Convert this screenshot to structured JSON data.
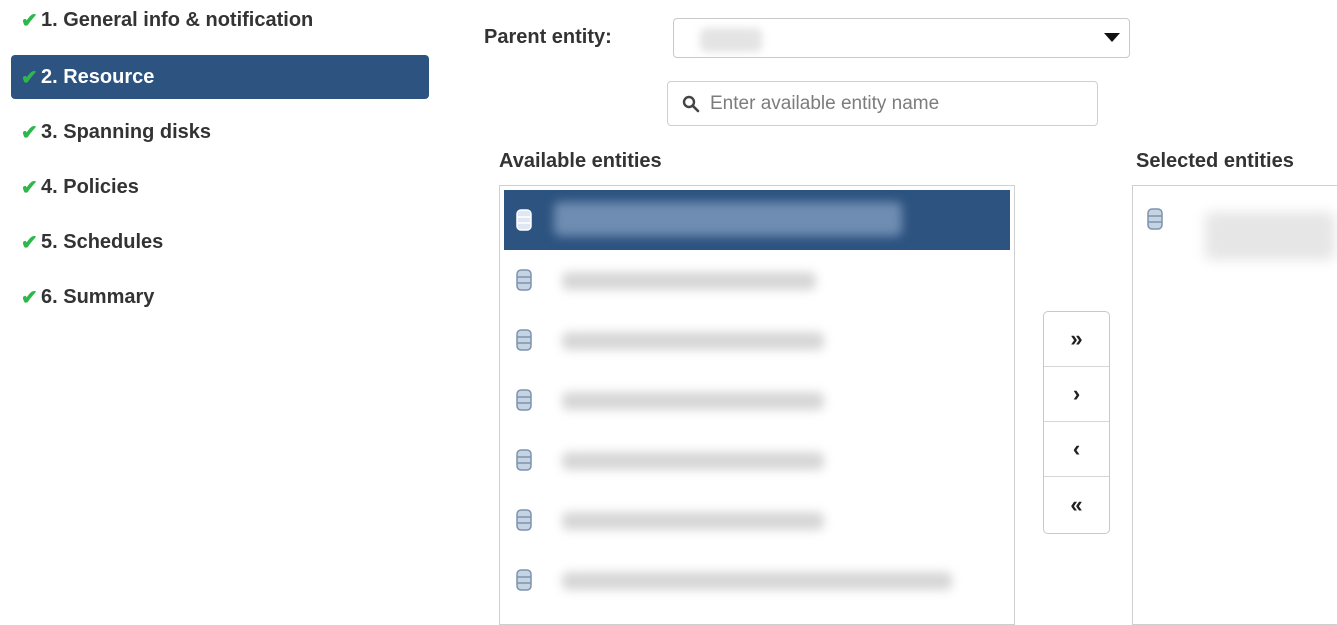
{
  "wizard": {
    "steps": [
      {
        "label": "1. General info & notification",
        "check": "✔"
      },
      {
        "label": "2. Resource",
        "check": "✔"
      },
      {
        "label": "3. Spanning disks",
        "check": "✔"
      },
      {
        "label": "4. Policies",
        "check": "✔"
      },
      {
        "label": "5. Schedules",
        "check": "✔"
      },
      {
        "label": "6. Summary",
        "check": "✔"
      }
    ],
    "active_step": 2
  },
  "parent_entity": {
    "label": "Parent entity:"
  },
  "search": {
    "placeholder": "Enter available entity name",
    "value": ""
  },
  "available": {
    "heading": "Available entities",
    "row_icon": "database-icon",
    "selected_index": 0
  },
  "selected": {
    "heading": "Selected entities",
    "row_icon": "database-icon"
  },
  "transfer": {
    "add_all": "»",
    "add_one": "›",
    "remove_one": "‹",
    "remove_all": "«"
  },
  "colors": {
    "accent": "#2d5380",
    "check": "#2db84b",
    "border": "#cfcfcf"
  }
}
